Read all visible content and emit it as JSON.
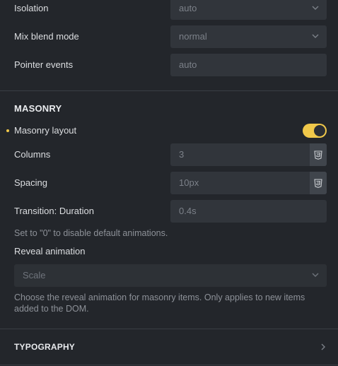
{
  "layout_settings": {
    "isolation": {
      "label": "Isolation",
      "value": "auto"
    },
    "mix_blend_mode": {
      "label": "Mix blend mode",
      "value": "normal"
    },
    "pointer_events": {
      "label": "Pointer events",
      "placeholder": "auto"
    }
  },
  "masonry": {
    "title": "MASONRY",
    "layout": {
      "label": "Masonry layout",
      "enabled": true
    },
    "columns": {
      "label": "Columns",
      "placeholder": "3"
    },
    "spacing": {
      "label": "Spacing",
      "placeholder": "10px"
    },
    "transition_duration": {
      "label": "Transition: Duration",
      "placeholder": "0.4s",
      "help": "Set to \"0\" to disable default animations."
    },
    "reveal_animation": {
      "label": "Reveal animation",
      "value": "Scale",
      "help": "Choose the reveal animation for masonry items. Only applies to new items added to the DOM."
    }
  },
  "typography": {
    "title": "TYPOGRAPHY"
  },
  "colors": {
    "accent": "#f0c84a",
    "background": "#23262b",
    "input": "#31353b"
  }
}
